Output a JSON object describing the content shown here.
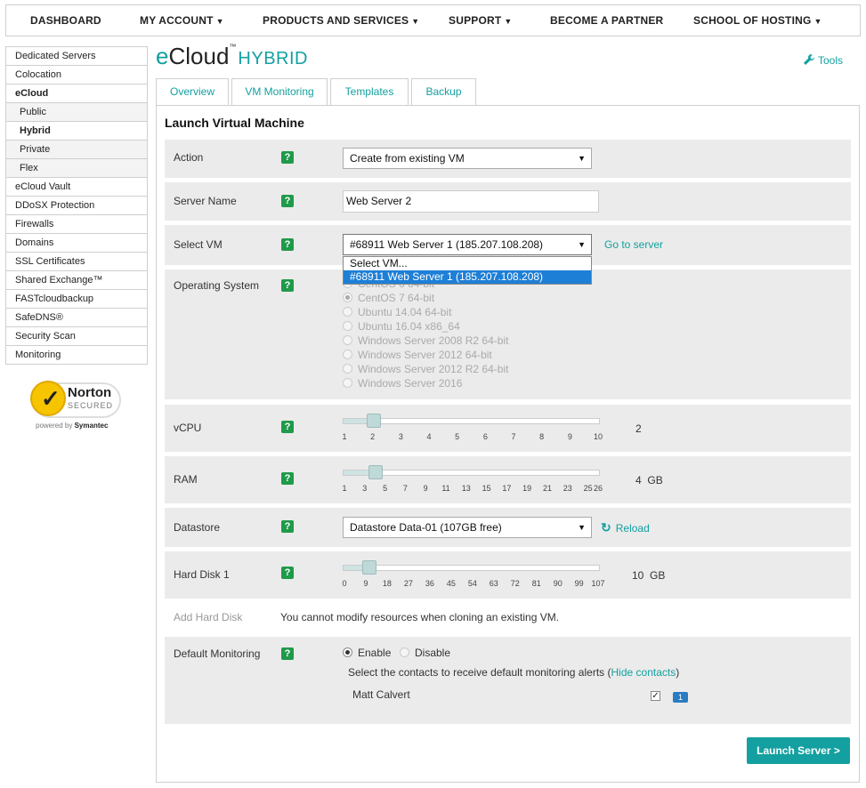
{
  "topnav": {
    "items": [
      {
        "label": "DASHBOARD",
        "caret": ""
      },
      {
        "label": "MY ACCOUNT",
        "caret": "▼"
      },
      {
        "label": "PRODUCTS AND SERVICES",
        "caret": "▼"
      },
      {
        "label": "SUPPORT",
        "caret": "▼"
      },
      {
        "label": "BECOME A PARTNER",
        "caret": ""
      },
      {
        "label": "SCHOOL OF HOSTING",
        "caret": "▼"
      }
    ]
  },
  "sidebar": {
    "items": [
      {
        "label": "Dedicated Servers"
      },
      {
        "label": "Colocation"
      },
      {
        "label": "eCloud"
      },
      {
        "label": "Public"
      },
      {
        "label": "Hybrid"
      },
      {
        "label": "Private"
      },
      {
        "label": "Flex"
      },
      {
        "label": "eCloud Vault"
      },
      {
        "label": "DDoSX Protection"
      },
      {
        "label": "Firewalls"
      },
      {
        "label": "Domains"
      },
      {
        "label": "SSL Certificates"
      },
      {
        "label": "Shared Exchange™"
      },
      {
        "label": "FASTcloudbackup"
      },
      {
        "label": "SafeDNS®"
      },
      {
        "label": "Security Scan"
      },
      {
        "label": "Monitoring"
      }
    ]
  },
  "norton": {
    "brand": "Norton",
    "secured": "SECURED",
    "powered_by": "powered by",
    "powered_brand": "Symantec"
  },
  "logo": {
    "e": "e",
    "cloud": "Cloud",
    "tm": "™",
    "product": "HYBRID"
  },
  "tools_label": "Tools",
  "tabs": [
    {
      "label": "Overview"
    },
    {
      "label": "VM Monitoring"
    },
    {
      "label": "Templates"
    },
    {
      "label": "Backup"
    }
  ],
  "form": {
    "title": "Launch Virtual Machine",
    "help_glyph": "?",
    "action": {
      "label": "Action",
      "value": "Create from existing VM"
    },
    "server_name": {
      "label": "Server Name",
      "value": "Web Server 2"
    },
    "select_vm": {
      "label": "Select VM",
      "value": "#68911 Web Server 1 (185.207.108.208)",
      "go_link": "Go to server",
      "options": [
        "Select VM...",
        "#68911 Web Server 1 (185.207.108.208)"
      ]
    },
    "os": {
      "label": "Operating System",
      "options": [
        "CentOS 6 64-bit",
        "CentOS 7 64-bit",
        "Ubuntu 14.04 64-bit",
        "Ubuntu 16.04 x86_64",
        "Windows Server 2008 R2 64-bit",
        "Windows Server 2012 64-bit",
        "Windows Server 2012 R2 64-bit",
        "Windows Server 2016"
      ],
      "selected": "CentOS 7 64-bit"
    },
    "vcpu": {
      "label": "vCPU",
      "value": "2",
      "ticks": [
        "1",
        "2",
        "3",
        "4",
        "5",
        "6",
        "7",
        "8",
        "9",
        "10"
      ],
      "min": 1,
      "max": 10
    },
    "ram": {
      "label": "RAM",
      "value": "4",
      "unit": "GB",
      "ticks": [
        "1",
        "3",
        "5",
        "7",
        "9",
        "11",
        "13",
        "15",
        "17",
        "19",
        "21",
        "23",
        "25",
        "26"
      ],
      "min": 1,
      "max": 26
    },
    "datastore": {
      "label": "Datastore",
      "value": "Datastore Data-01 (107GB free)",
      "reload": "Reload"
    },
    "hard_disk": {
      "label": "Hard Disk 1",
      "value": "10",
      "unit": "GB",
      "ticks": [
        "0",
        "9",
        "18",
        "27",
        "36",
        "45",
        "54",
        "63",
        "72",
        "81",
        "90",
        "99",
        "107"
      ],
      "min": 0,
      "max": 107
    },
    "add_disk": {
      "label": "Add Hard Disk",
      "message": "You cannot modify resources when cloning an existing VM."
    },
    "monitoring": {
      "label": "Default Monitoring",
      "enable": "Enable",
      "disable": "Disable",
      "contacts_text": "Select the contacts to receive default monitoring alerts",
      "paren_open": "(",
      "hide_link": "Hide contacts",
      "paren_close": ")",
      "contact_name": "Matt Calvert",
      "contact_checked": "✓",
      "contact_count": "1"
    },
    "launch_button": "Launch Server >"
  }
}
